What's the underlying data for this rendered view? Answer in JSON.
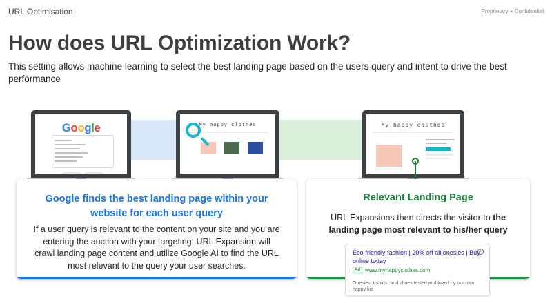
{
  "header": {
    "section_label": "URL Optimisation",
    "confidential": "Proprietary + Confidential",
    "title": "How does URL Optimization Work?",
    "subtitle": "This setting allows machine learning to select the best landing page based on the users query and intent to drive the best performance"
  },
  "laptops": {
    "search": {
      "logo": "Google"
    },
    "site": {
      "shop_title": "My happy clothes"
    },
    "landing": {
      "shop_title": "My happy clothes"
    }
  },
  "left_card": {
    "title": "Google finds the best landing page within your website for each user query",
    "body": "If a user query is relevant to the content on your site and you are entering the auction with your targeting. URL Expansion will crawl landing page content and utilize Google AI to find the URL most relevant to the query your user searches."
  },
  "right_card": {
    "title": "Relevant Landing Page",
    "body_plain": "URL Expansions then directs the visitor to ",
    "body_bold": "the landing page most relevant to his/her query"
  },
  "ad": {
    "headline": "Eco-friendly fashion | 20% off all onesies | Buy online today",
    "badge": "Ad",
    "url": "www.myhappyclothes.com",
    "description": "Onesies, t-shirts, and shoes tested and loved by our own happy kid"
  },
  "colors": {
    "blue": "#1a73e8",
    "green": "#188038",
    "magnifier": "#12b5cb"
  }
}
